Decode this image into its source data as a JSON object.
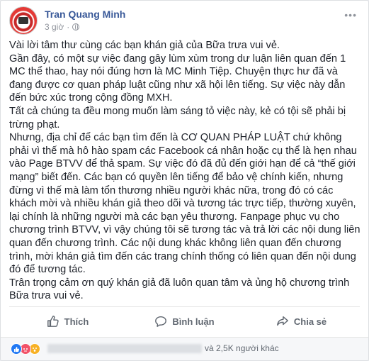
{
  "post": {
    "author": "Tran Quang Minh",
    "time": "3 giờ",
    "more_label": "•••",
    "paragraphs": [
      "Vài lời tâm thư cùng các bạn khán giả của Bữa trưa vui vẻ.",
      "Gần đây, có một sự việc đang gây lùm xùm trong dư luận liên quan đến 1 MC thể thao, hay nói đúng hơn là MC Minh Tiệp. Chuyện thực hư đã và đang được cơ quan pháp luật cũng như xã hội lên tiếng. Sự việc này dẫn đến bức xúc trong cộng đồng MXH.",
      "Tất cả chúng ta đều mong muốn làm sáng tỏ việc này, kẻ có tội sẽ phải bị trừng phạt.",
      "Nhưng, địa chỉ để các bạn tìm đến là CƠ QUAN PHÁP LUẬT chứ không phải vì thế mà hô hào spam các Facebook cá nhân hoặc cụ thể là hẹn nhau vào Page BTVV để thả spam. Sự việc đó đã đủ đến giới hạn để cả “thế giới mạng” biết đến. Các bạn có quyền lên tiếng để bảo vệ chính kiến, nhưng đừng vì thế mà làm tổn thương nhiều người khác nữa, trong đó có các khách mời và nhiều khán giả theo dõi và tương tác trực tiếp, thường xuyên, lại chính là những người mà các bạn yêu thương. Fanpage phục vụ cho chương trình BTVV, vì vậy chúng tôi sẽ tương tác và trả lời các nội dung liên quan đến chương trình. Các nội dung khác không liên quan đến chương trình, mời khán giả tìm đến các trang chính thống có liên quan đến nội dung đó để tương tác.",
      "Trân trọng cảm ơn quý khán giả đã luôn quan tâm và ủng hộ chương trình Bữa trưa vui vẻ."
    ]
  },
  "actions": {
    "like": "Thích",
    "comment": "Bình luận",
    "share": "Chia sẻ"
  },
  "reactions": {
    "summary": "và 2,5K người khác",
    "colors": {
      "like": "#2078f4",
      "angry": "#f25268",
      "wow": "#f7b125"
    }
  }
}
